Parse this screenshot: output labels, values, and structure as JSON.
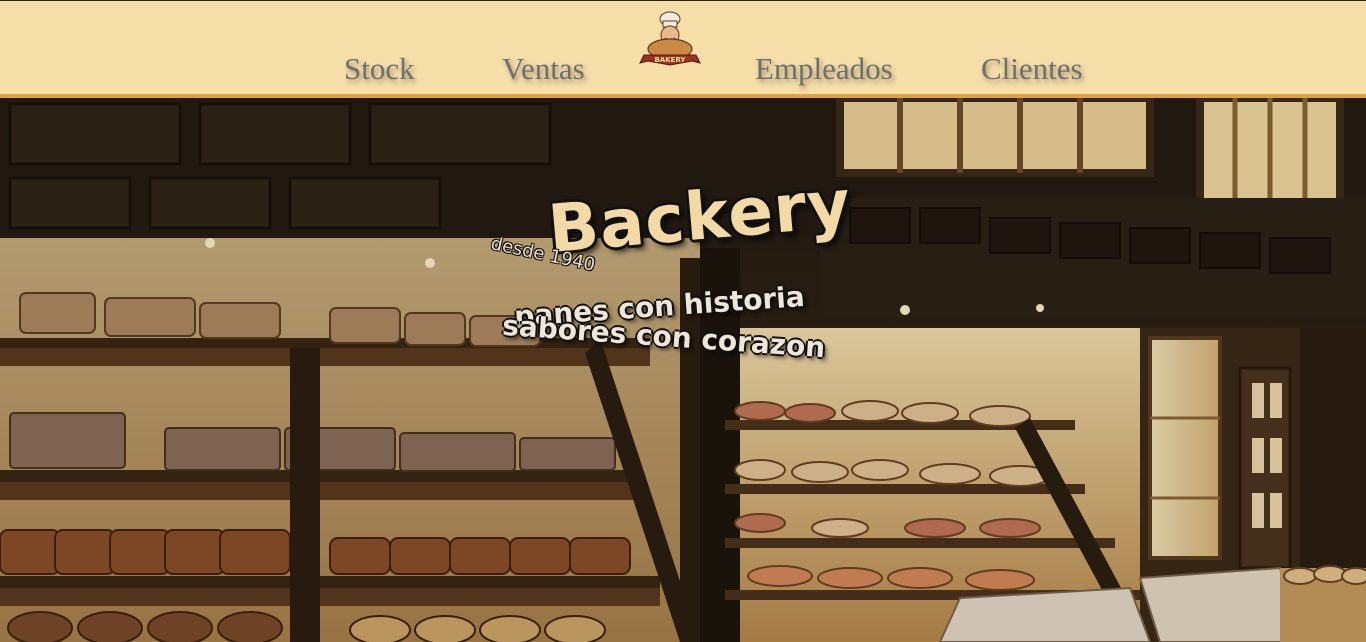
{
  "nav": {
    "items": [
      {
        "label": "Stock"
      },
      {
        "label": "Ventas"
      },
      {
        "label": "Empleados"
      },
      {
        "label": "Clientes"
      }
    ],
    "logo": {
      "icon": "bakery-logo-icon",
      "text": "BAKERY"
    }
  },
  "hero": {
    "title": "Backery",
    "since": "desde 1940",
    "tagline_1": "panes con historia",
    "tagline_2": "sabores con corazon"
  },
  "colors": {
    "nav_background": "#f6dea9",
    "nav_border": "#e0a43c",
    "nav_text": "#6f6f6f",
    "hero_title": "#f3d9a3"
  }
}
